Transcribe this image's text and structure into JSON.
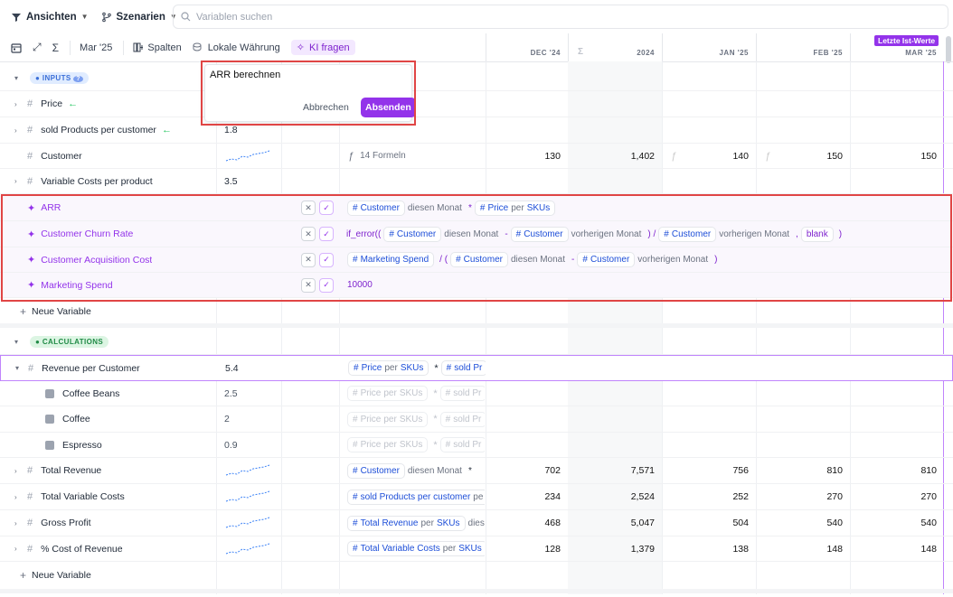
{
  "topbar": {
    "views": "Ansichten",
    "scenarios": "Szenarien",
    "search_placeholder": "Variablen suchen"
  },
  "toolbar": {
    "period": "Mar '25",
    "columns": "Spalten",
    "currency": "Lokale Währung",
    "ai": "KI fragen"
  },
  "columns": {
    "dec": "DEC '24",
    "sum": "Σ",
    "y2024": "2024",
    "jan": "JAN '25",
    "feb": "FEB '25",
    "mar": "MAR '25",
    "actuals_badge": "Letzte Ist-Werte"
  },
  "popup": {
    "input": "ARR berechnen",
    "cancel": "Abbrechen",
    "submit": "Absenden"
  },
  "sections": {
    "inputs": "INPUTS",
    "calculations": "CALCULATIONS",
    "new_variable": "Neue Variable"
  },
  "inputs": {
    "price": {
      "name": "Price"
    },
    "sold": {
      "name": "sold Products per customer",
      "value": "1.8"
    },
    "customer": {
      "name": "Customer",
      "formulas": "14 Formeln",
      "dec": "130",
      "y2024": "1,402",
      "jan": "140",
      "feb": "150",
      "mar": "150"
    },
    "varcost": {
      "name": "Variable Costs per product",
      "value": "3.5"
    }
  },
  "ai_rows": {
    "arr": {
      "name": "ARR"
    },
    "churn": {
      "name": "Customer Churn Rate"
    },
    "cac": {
      "name": "Customer Acquisition Cost"
    },
    "mkt": {
      "name": "Marketing Spend",
      "value": "10000"
    }
  },
  "formula": {
    "customer": "Customer",
    "price": "Price",
    "per": "per",
    "skus": "SKUs",
    "this_month": "diesen Monat",
    "prev_month": "vorherigen Monat",
    "if_error": "if_error((",
    "blank": "blank",
    "marketing": "Marketing Spend",
    "sold": "sold Products per customer",
    "total_revenue": "Total Revenue",
    "total_varcost": "Total Variable Costs",
    "sold_trunc": "sold Pr",
    "pe": "pe",
    "dies": "dies"
  },
  "calc": {
    "rpc": {
      "name": "Revenue per Customer",
      "value": "5.4"
    },
    "beans": {
      "name": "Coffee Beans",
      "value": "2.5"
    },
    "coffee": {
      "name": "Coffee",
      "value": "2"
    },
    "espresso": {
      "name": "Espresso",
      "value": "0.9"
    },
    "trev": {
      "name": "Total Revenue",
      "dec": "702",
      "y2024": "7,571",
      "jan": "756",
      "feb": "810",
      "mar": "810"
    },
    "tvc": {
      "name": "Total Variable Costs",
      "dec": "234",
      "y2024": "2,524",
      "jan": "252",
      "feb": "270",
      "mar": "270"
    },
    "gp": {
      "name": "Gross Profit",
      "dec": "468",
      "y2024": "5,047",
      "jan": "504",
      "feb": "540",
      "mar": "540"
    },
    "pcr": {
      "name": "% Cost of Revenue",
      "dec": "128",
      "y2024": "1,379",
      "jan": "138",
      "feb": "148",
      "mar": "148"
    }
  },
  "colors": {
    "accent": "#9333ea",
    "highlight_box": "#e04545",
    "pill_text": "#1d4ed8"
  }
}
